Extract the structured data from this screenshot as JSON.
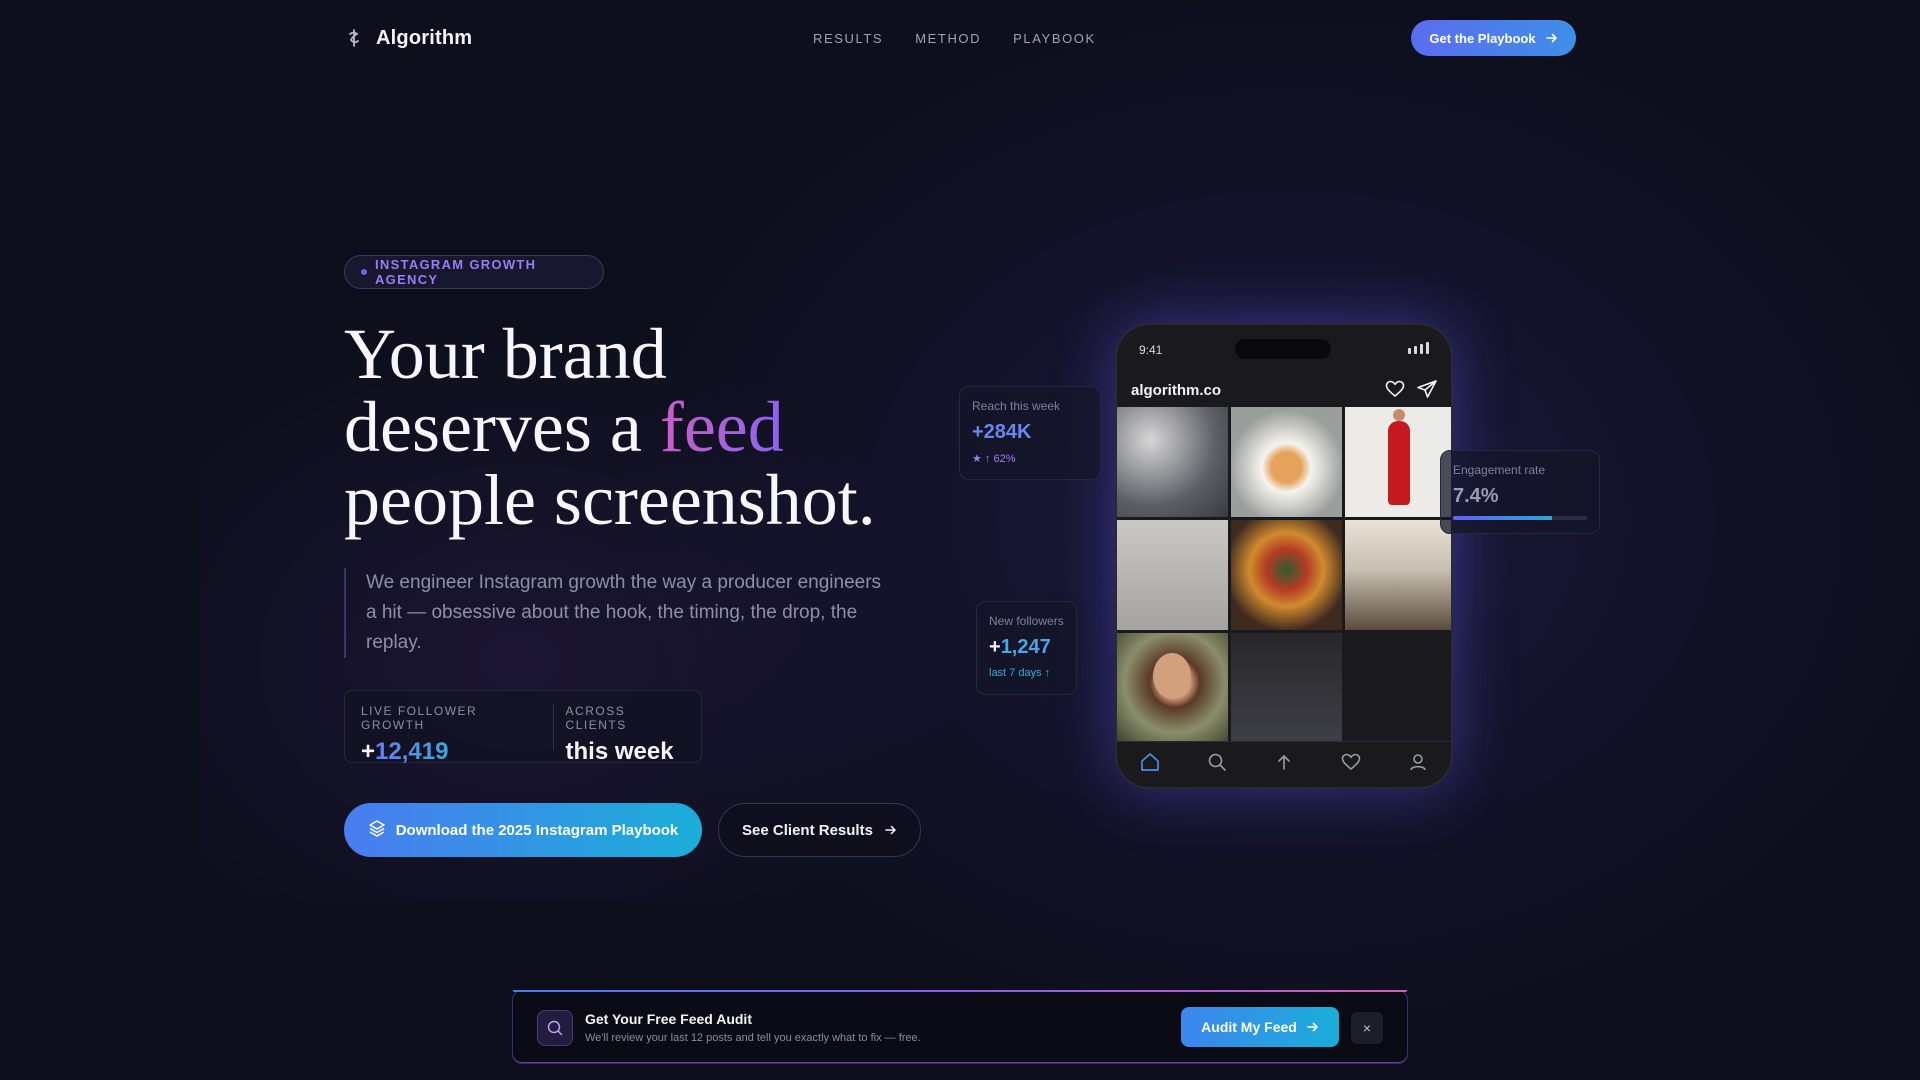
{
  "brand": {
    "name": "Algorithm"
  },
  "nav": {
    "links": [
      "RESULTS",
      "METHOD",
      "PLAYBOOK"
    ],
    "cta": "Get the Playbook"
  },
  "hero": {
    "badge": "INSTAGRAM GROWTH AGENCY",
    "headline_line1": "Your brand",
    "headline_line2_pre": "deserves a ",
    "headline_line2_accent": "feed",
    "headline_line3": "people screenshot.",
    "subtext": "We engineer Instagram growth the way a producer engineers a hit — obsessive about the hook, the timing, the drop, the replay.",
    "stats": [
      {
        "label": "LIVE FOLLOWER GROWTH",
        "prefix": "+",
        "value": "12,419"
      },
      {
        "label": "ACROSS CLIENTS",
        "value": "this week"
      }
    ],
    "primary_button": "Download the 2025 Instagram Playbook",
    "secondary_button": "See Client Results"
  },
  "phone": {
    "time": "9:41",
    "handle": "algorithm.co"
  },
  "cards": {
    "reach": {
      "label": "Reach this week",
      "value": "+284K",
      "sub": "★ ↑ 62%"
    },
    "followers": {
      "label": "New followers",
      "prefix": "+",
      "value": "1,247",
      "sub": "last 7 days ↑"
    },
    "engagement": {
      "label": "Engagement rate",
      "value": "7.4%",
      "fill": 0.74
    }
  },
  "banner": {
    "title": "Get Your Free Feed Audit",
    "description": "We'll review your last 12 posts and tell you exactly what to fix — free.",
    "button": "Audit My Feed",
    "close": "×"
  },
  "colors": {
    "accent_purple": "#8a63ee",
    "accent_blue": "#4a7cf0",
    "accent_cyan": "#1aaed8",
    "background": "#0d0f1d"
  }
}
